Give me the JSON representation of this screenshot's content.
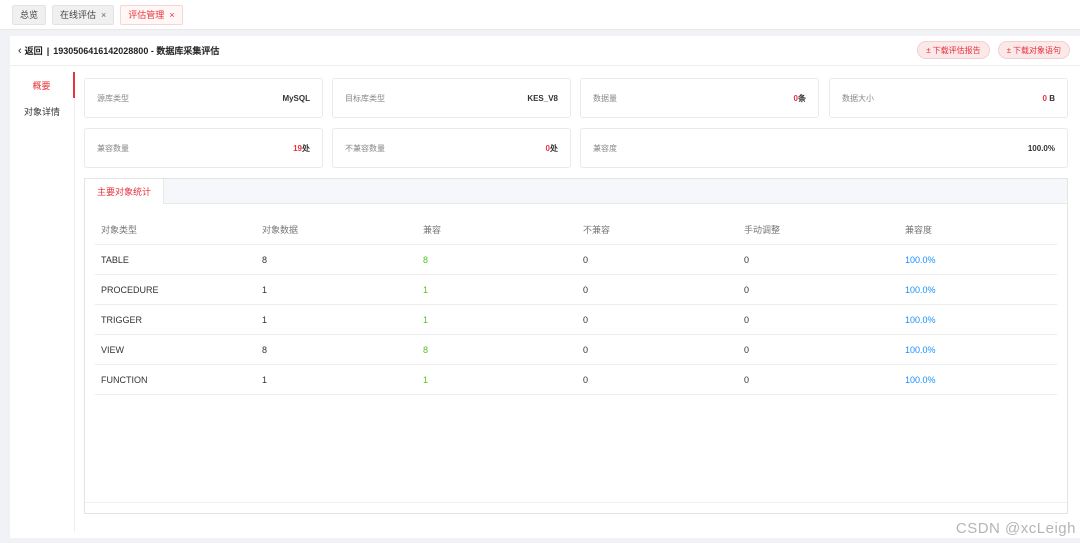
{
  "tabs": [
    {
      "label": "总览",
      "closable": false,
      "active": false
    },
    {
      "label": "在线评估",
      "closable": true,
      "active": false
    },
    {
      "label": "评估管理",
      "closable": true,
      "active": true
    }
  ],
  "close_glyph": "×",
  "header": {
    "back_label": "返回",
    "separator": "|",
    "title": "1930506416142028800 - 数据库采集评估",
    "download_report": "下载评估报告",
    "download_sql": "下载对象语句",
    "download_icon_glyph": "±"
  },
  "sidebar": {
    "items": [
      {
        "label": "概要",
        "active": true
      },
      {
        "label": "对象详情",
        "active": false
      }
    ]
  },
  "stats": {
    "source_type": {
      "label": "源库类型",
      "value": "MySQL"
    },
    "target_type": {
      "label": "目标库类型",
      "value": "KES_V8"
    },
    "data_count": {
      "label": "数据量",
      "value": "0",
      "unit": "条"
    },
    "data_size": {
      "label": "数据大小",
      "value": "0",
      "unit": "B"
    },
    "compatible_count": {
      "label": "兼容数量",
      "value": "19",
      "unit": "处"
    },
    "incompatible_count": {
      "label": "不兼容数量",
      "value": "0",
      "unit": "处"
    },
    "compat_rate": {
      "label": "兼容度",
      "value": "100.0%"
    }
  },
  "panel": {
    "tab_label": "主要对象统计",
    "columns": [
      "对象类型",
      "对象数据",
      "兼容",
      "不兼容",
      "手动调整",
      "兼容度"
    ],
    "rows": [
      [
        "TABLE",
        "8",
        "8",
        "0",
        "0",
        "100.0%"
      ],
      [
        "PROCEDURE",
        "1",
        "1",
        "0",
        "0",
        "100.0%"
      ],
      [
        "TRIGGER",
        "1",
        "1",
        "0",
        "0",
        "100.0%"
      ],
      [
        "VIEW",
        "8",
        "8",
        "0",
        "0",
        "100.0%"
      ],
      [
        "FUNCTION",
        "1",
        "1",
        "0",
        "0",
        "100.0%"
      ]
    ]
  },
  "watermark": "CSDN @xcLeigh",
  "colors": {
    "accent": "#e8323c",
    "compatible": "#52c41a",
    "rate": "#1890ff"
  }
}
